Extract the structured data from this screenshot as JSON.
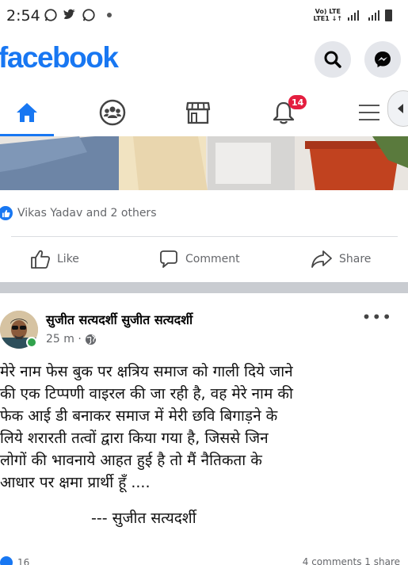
{
  "status_bar": {
    "time": "2:54",
    "network_top": "Vo) LTE",
    "network_bottom": "LTE1 ↓↑"
  },
  "header": {
    "brand": "facebook",
    "brand_color": "#1877f2",
    "search_icon": "search-icon",
    "messenger_icon": "messenger-icon"
  },
  "nav": {
    "tabs": [
      {
        "icon": "home-icon",
        "active": true
      },
      {
        "icon": "groups-icon",
        "active": false
      },
      {
        "icon": "marketplace-icon",
        "active": false
      },
      {
        "icon": "notifications-icon",
        "active": false,
        "badge": "14"
      },
      {
        "icon": "menu-icon",
        "active": false
      }
    ]
  },
  "post1": {
    "reactions_text": "Vikas Yadav  and 2 others",
    "like_label": "Like",
    "comment_label": "Comment",
    "share_label": "Share"
  },
  "post2": {
    "author": "सुजीत सत्यदर्शी सुजीत सत्यदर्शी",
    "time": "25 m ·",
    "body": "मेरे नाम फेस बुक पर क्षत्रिय समाज को गाली दिये जाने\nकी एक टिप्पणी वाइरल की जा रही है, वह मेरे नाम की\nफेक आई डी बनाकर समाज में मेरी छवि बिगाड़ने के\nलिये शरारती तत्वों द्वारा किया गया है, जिससे जिन\nलोगों की भावनाये आहत हुई है तो मैं  नैतिकता के\nआधार पर क्षमा प्रार्थी हूँ ....",
    "signature": "--- सुजीत सत्यदर्शी",
    "likes_count": "16",
    "counts_right": "4 comments   1 share"
  }
}
